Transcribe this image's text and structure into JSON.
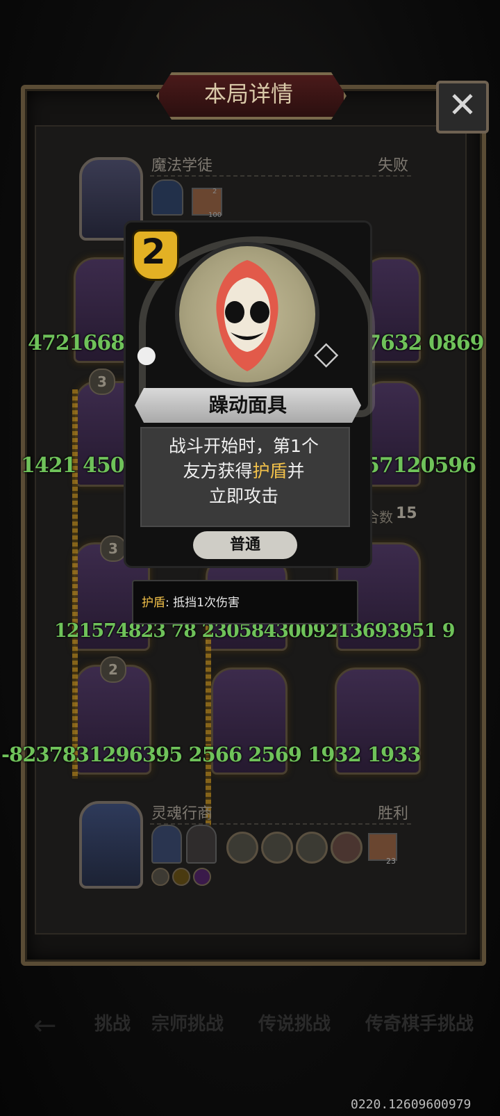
{
  "dialog": {
    "title": "本局详情",
    "close_label": "✕"
  },
  "players": [
    {
      "name": "魔法学徒",
      "result": "失败",
      "extra_count": "2",
      "extra_count2": "100"
    },
    {
      "name": "灵魂行商",
      "result": "胜利",
      "extra_count": "23"
    }
  ],
  "round_label": "合数",
  "round_value": "15",
  "slot_levels": [
    "3",
    "3",
    "2"
  ],
  "card": {
    "cost": "2",
    "name": "躁动面具",
    "desc_line1": "战斗开始时，第1个",
    "desc_line2_a": "友方获得",
    "desc_line2_hl": "护盾",
    "desc_line2_b": "并",
    "desc_line3": "立即攻击",
    "rarity": "普通"
  },
  "tooltip": {
    "keyword": "护盾",
    "text": ": 抵挡1次伤害"
  },
  "debug_numbers": {
    "row1_left": "4721668",
    "row1_right": "7632 0869",
    "row2_left": "1421 450",
    "row2_right": "57120596",
    "row3": "121574823 78 2305843009213693951 9",
    "row4": "-8237831296395 2566 2569 1932 1933"
  },
  "bottom_nav": [
    "挑战",
    "宗师挑战",
    "传说挑战",
    "传奇棋手挑战"
  ],
  "version": "0220.12609600979",
  "colors": {
    "accent_gold": "#e3b124",
    "debug_green": "#6fc25a",
    "shield_highlight": "#f2c14a"
  }
}
